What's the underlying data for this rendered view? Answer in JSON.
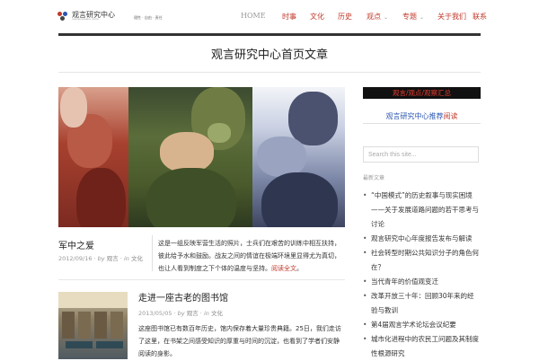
{
  "header": {
    "logo_title": "观言研究中心",
    "logo_subtitle": "GUANYAN RESEARCH CENTER",
    "tagline": "理性 · 自由 · 责任",
    "nav": [
      {
        "label": "HOME",
        "has_dropdown": false
      },
      {
        "label": "时事",
        "has_dropdown": false
      },
      {
        "label": "文化",
        "has_dropdown": false
      },
      {
        "label": "历史",
        "has_dropdown": false
      },
      {
        "label": "观点",
        "has_dropdown": true
      },
      {
        "label": "专题",
        "has_dropdown": true
      },
      {
        "label": "关于我们",
        "has_dropdown": false
      },
      {
        "label": "联系",
        "has_dropdown": false
      }
    ]
  },
  "page_title": "观言研究中心首页文章",
  "posts": [
    {
      "title": "军中之爱",
      "date": "2012/09/16",
      "by_label": "by",
      "author": "观言",
      "in_label": "in",
      "category": "文化",
      "excerpt": "这是一组反映军营生活的照片，士兵们在艰苦的训练中相互扶持，彼此给予水和鼓励。战友之间的情谊在极端环境里显得尤为真切，也让人看到制度之下个体的温度与坚持。",
      "more": "阅读全文"
    },
    {
      "title": "走进一座古老的图书馆",
      "date": "2013/05/05",
      "by_label": "by",
      "author": "观言",
      "in_label": "in",
      "category": "文化",
      "excerpt": "这座图书馆已有数百年历史，馆内保存着大量珍贵典籍。25日，我们走访了这里，在书架之间感受知识的厚重与时间的沉淀，也看到了学者们安静阅读的身影。"
    }
  ],
  "sidebar": {
    "banner": "观言/观点/观察汇总",
    "link_blue": "观言研究中心推荐",
    "link_red": "阅读",
    "search_placeholder": "Search this site...",
    "recent_heading": "最新文章",
    "recent_posts": [
      "“中国模式”的历史叙事与现实困境——关于发展道路问题的若干思考与讨论",
      "观言研究中心年度报告发布与解读",
      "社会转型时期公共知识分子的角色何在？",
      "当代青年的价值观变迁",
      "改革开放三十年：回顾30年来的经验与教训",
      "第4届观言学术论坛会议纪要",
      "城市化进程中的农民工问题及其制度性根源研究"
    ]
  },
  "colors": {
    "accent": "#c0392b",
    "link_blue": "#2a55b0",
    "banner_bg": "#111111",
    "rule": "#333333"
  }
}
